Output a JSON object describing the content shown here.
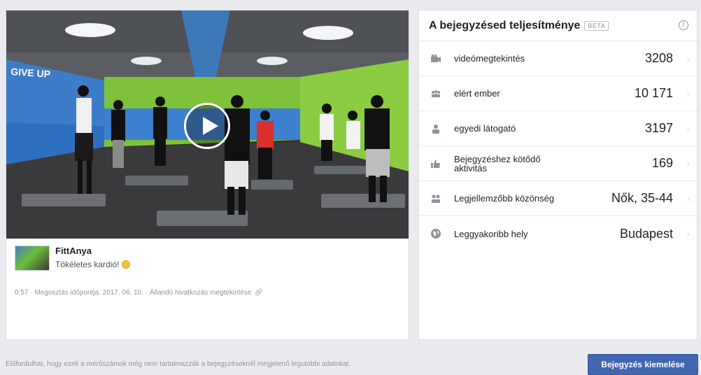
{
  "post": {
    "page_name": "FittAnya",
    "text": "Tökéletes kardió!",
    "meta": "0:57 · Megosztás időpontja: 2017. 06. 10. · Állandó hivatkozás megtekintése",
    "video_wall_text": "GIVE UP"
  },
  "performance": {
    "title": "A bejegyzésed teljesítménye",
    "badge": "BETA",
    "metrics": [
      {
        "icon": "video-icon",
        "label": "videómegtekintés",
        "value": "3208"
      },
      {
        "icon": "people-reached-icon",
        "label": "elért ember",
        "value": "10 171"
      },
      {
        "icon": "person-icon",
        "label": "egyedi látogató",
        "value": "3197"
      },
      {
        "icon": "like-icon",
        "label": "Bejegyzéshez kötődő aktivitás",
        "value": "169"
      },
      {
        "icon": "audience-icon",
        "label": "Legjellemzőbb közönség",
        "value": "Nők, 35-44"
      },
      {
        "icon": "globe-icon",
        "label": "Leggyakoribb hely",
        "value": "Budapest"
      }
    ]
  },
  "footer": {
    "disclaimer": "Előfordulhat, hogy ezek a mérőszámok még nem tartalmazzák a bejegyzéseknél megjelenő legutóbbi adatokat.",
    "boost_label": "Bejegyzés kiemelése"
  },
  "colors": {
    "accent": "#4267b2",
    "wall_green": "#7ec23a",
    "wall_blue": "#3d7cc9"
  }
}
